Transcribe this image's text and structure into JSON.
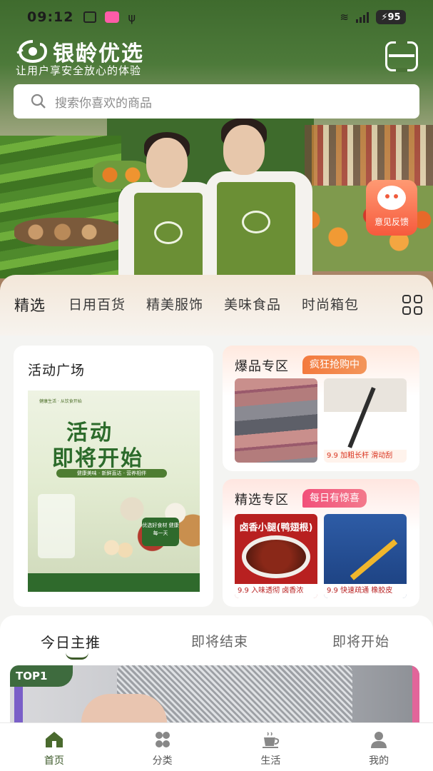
{
  "status_bar": {
    "time": "09:12",
    "battery": "95"
  },
  "header": {
    "brand_name": "银龄优选",
    "tagline": "让用户享安全放心的体验",
    "search_placeholder": "搜索你喜欢的商品"
  },
  "feedback": {
    "label": "意见反馈"
  },
  "categories": [
    "精选",
    "日用百货",
    "精美服饰",
    "美味食品",
    "时尚箱包"
  ],
  "activity": {
    "title": "活动广场",
    "poster_head": "健康生活 · 从饮食开始",
    "poster_line1": "活动",
    "poster_line2": "即将开始",
    "poster_ribbon": "健康美味 · 新鲜直达 · 营养相伴",
    "poster_badge": "优选好食材 健康每一天"
  },
  "hot_zone": {
    "title": "爆品专区",
    "tag": "疯狂抢购中",
    "item2_caption": "9.9 加粗长杆 滑动刮"
  },
  "pick_zone": {
    "title": "精选专区",
    "tag": "每日有惊喜",
    "item1_top": "卤香小腿(鸭翅根)",
    "item1_caption": "9.9 入味透彻 卤香浓",
    "item2_caption": "9.9 快速疏通 橡胶皮"
  },
  "recommend": {
    "tabs": [
      "今日主推",
      "即将结束",
      "即将开始"
    ],
    "badge": "TOP1"
  },
  "nav": [
    {
      "label": "首页",
      "icon": "home-icon"
    },
    {
      "label": "分类",
      "icon": "category-icon"
    },
    {
      "label": "生活",
      "icon": "coffee-icon"
    },
    {
      "label": "我的",
      "icon": "profile-icon"
    }
  ],
  "colors": {
    "brand_green": "#3d5a2a",
    "accent_orange": "#f37a3e",
    "accent_pink": "#f2507a"
  }
}
